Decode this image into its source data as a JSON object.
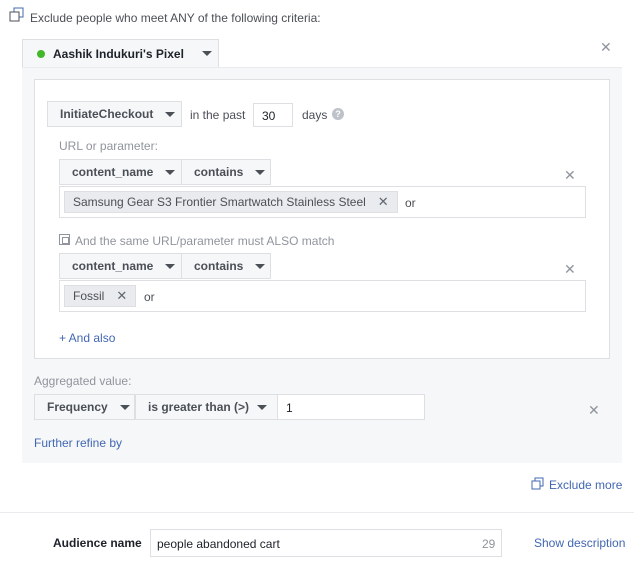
{
  "header": {
    "criteria_text": "Exclude people who meet ANY of the following criteria:"
  },
  "pixel": {
    "name": "Aashik Indukuri's Pixel",
    "status_color": "#42b72a"
  },
  "rule": {
    "event": "InitiateCheckout",
    "in_the_past_label": "in the past",
    "days_value": "30",
    "days_label": "days",
    "url_param_label": "URL or parameter:",
    "condition1": {
      "param": "content_name",
      "operator": "contains",
      "tokens": [
        "Samsung Gear S3 Frontier Smartwatch Stainless Steel"
      ],
      "or_label": "or"
    },
    "also_match_label": "And the same URL/parameter must ALSO match",
    "condition2": {
      "param": "content_name",
      "operator": "contains",
      "tokens": [
        "Fossil"
      ],
      "or_label": "or"
    },
    "and_also_link": "+ And also"
  },
  "aggregated": {
    "label": "Aggregated value:",
    "metric": "Frequency",
    "operator": "is greater than (>)",
    "value": "1"
  },
  "further_refine": "Further refine by",
  "exclude_more": "Exclude more",
  "audience": {
    "label": "Audience name",
    "value": "people abandoned cart",
    "char_count": "29",
    "show_description": "Show description"
  },
  "colors": {
    "link": "#4267b2",
    "panel_bg": "#f6f7f9",
    "border": "#dddfe2"
  }
}
